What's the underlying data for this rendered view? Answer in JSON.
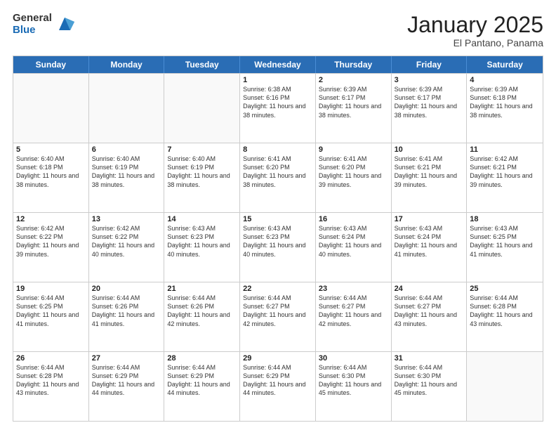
{
  "logo": {
    "general": "General",
    "blue": "Blue"
  },
  "header": {
    "month": "January 2025",
    "location": "El Pantano, Panama"
  },
  "weekdays": [
    "Sunday",
    "Monday",
    "Tuesday",
    "Wednesday",
    "Thursday",
    "Friday",
    "Saturday"
  ],
  "rows": [
    [
      {
        "day": "",
        "empty": true
      },
      {
        "day": "",
        "empty": true
      },
      {
        "day": "",
        "empty": true
      },
      {
        "day": "1",
        "sunrise": "6:38 AM",
        "sunset": "6:16 PM",
        "daylight": "11 hours and 38 minutes."
      },
      {
        "day": "2",
        "sunrise": "6:39 AM",
        "sunset": "6:17 PM",
        "daylight": "11 hours and 38 minutes."
      },
      {
        "day": "3",
        "sunrise": "6:39 AM",
        "sunset": "6:17 PM",
        "daylight": "11 hours and 38 minutes."
      },
      {
        "day": "4",
        "sunrise": "6:39 AM",
        "sunset": "6:18 PM",
        "daylight": "11 hours and 38 minutes."
      }
    ],
    [
      {
        "day": "5",
        "sunrise": "6:40 AM",
        "sunset": "6:18 PM",
        "daylight": "11 hours and 38 minutes."
      },
      {
        "day": "6",
        "sunrise": "6:40 AM",
        "sunset": "6:19 PM",
        "daylight": "11 hours and 38 minutes."
      },
      {
        "day": "7",
        "sunrise": "6:40 AM",
        "sunset": "6:19 PM",
        "daylight": "11 hours and 38 minutes."
      },
      {
        "day": "8",
        "sunrise": "6:41 AM",
        "sunset": "6:20 PM",
        "daylight": "11 hours and 38 minutes."
      },
      {
        "day": "9",
        "sunrise": "6:41 AM",
        "sunset": "6:20 PM",
        "daylight": "11 hours and 39 minutes."
      },
      {
        "day": "10",
        "sunrise": "6:41 AM",
        "sunset": "6:21 PM",
        "daylight": "11 hours and 39 minutes."
      },
      {
        "day": "11",
        "sunrise": "6:42 AM",
        "sunset": "6:21 PM",
        "daylight": "11 hours and 39 minutes."
      }
    ],
    [
      {
        "day": "12",
        "sunrise": "6:42 AM",
        "sunset": "6:22 PM",
        "daylight": "11 hours and 39 minutes."
      },
      {
        "day": "13",
        "sunrise": "6:42 AM",
        "sunset": "6:22 PM",
        "daylight": "11 hours and 40 minutes."
      },
      {
        "day": "14",
        "sunrise": "6:43 AM",
        "sunset": "6:23 PM",
        "daylight": "11 hours and 40 minutes."
      },
      {
        "day": "15",
        "sunrise": "6:43 AM",
        "sunset": "6:23 PM",
        "daylight": "11 hours and 40 minutes."
      },
      {
        "day": "16",
        "sunrise": "6:43 AM",
        "sunset": "6:24 PM",
        "daylight": "11 hours and 40 minutes."
      },
      {
        "day": "17",
        "sunrise": "6:43 AM",
        "sunset": "6:24 PM",
        "daylight": "11 hours and 41 minutes."
      },
      {
        "day": "18",
        "sunrise": "6:43 AM",
        "sunset": "6:25 PM",
        "daylight": "11 hours and 41 minutes."
      }
    ],
    [
      {
        "day": "19",
        "sunrise": "6:44 AM",
        "sunset": "6:25 PM",
        "daylight": "11 hours and 41 minutes."
      },
      {
        "day": "20",
        "sunrise": "6:44 AM",
        "sunset": "6:26 PM",
        "daylight": "11 hours and 41 minutes."
      },
      {
        "day": "21",
        "sunrise": "6:44 AM",
        "sunset": "6:26 PM",
        "daylight": "11 hours and 42 minutes."
      },
      {
        "day": "22",
        "sunrise": "6:44 AM",
        "sunset": "6:27 PM",
        "daylight": "11 hours and 42 minutes."
      },
      {
        "day": "23",
        "sunrise": "6:44 AM",
        "sunset": "6:27 PM",
        "daylight": "11 hours and 42 minutes."
      },
      {
        "day": "24",
        "sunrise": "6:44 AM",
        "sunset": "6:27 PM",
        "daylight": "11 hours and 43 minutes."
      },
      {
        "day": "25",
        "sunrise": "6:44 AM",
        "sunset": "6:28 PM",
        "daylight": "11 hours and 43 minutes."
      }
    ],
    [
      {
        "day": "26",
        "sunrise": "6:44 AM",
        "sunset": "6:28 PM",
        "daylight": "11 hours and 43 minutes."
      },
      {
        "day": "27",
        "sunrise": "6:44 AM",
        "sunset": "6:29 PM",
        "daylight": "11 hours and 44 minutes."
      },
      {
        "day": "28",
        "sunrise": "6:44 AM",
        "sunset": "6:29 PM",
        "daylight": "11 hours and 44 minutes."
      },
      {
        "day": "29",
        "sunrise": "6:44 AM",
        "sunset": "6:29 PM",
        "daylight": "11 hours and 44 minutes."
      },
      {
        "day": "30",
        "sunrise": "6:44 AM",
        "sunset": "6:30 PM",
        "daylight": "11 hours and 45 minutes."
      },
      {
        "day": "31",
        "sunrise": "6:44 AM",
        "sunset": "6:30 PM",
        "daylight": "11 hours and 45 minutes."
      },
      {
        "day": "",
        "empty": true
      }
    ]
  ]
}
